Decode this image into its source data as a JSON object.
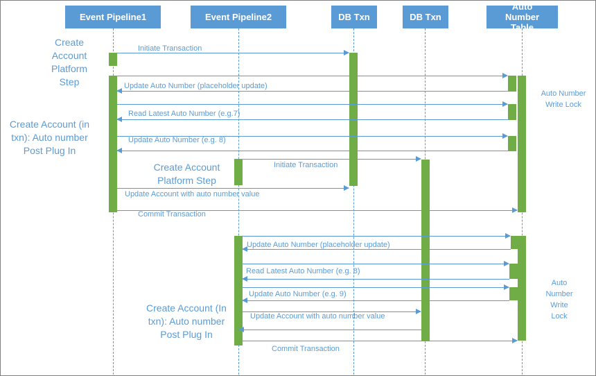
{
  "diagram": {
    "type": "sequence",
    "participants": [
      {
        "id": "ep1",
        "label": "Event Pipeline1"
      },
      {
        "id": "ep2",
        "label": "Event Pipeline2"
      },
      {
        "id": "db1",
        "label": "DB Txn"
      },
      {
        "id": "db2",
        "label": "DB Txn"
      },
      {
        "id": "ant",
        "label": "Auto Number Table"
      }
    ],
    "notes": {
      "ep1_platform": "Create Account Platform Step",
      "ep1_plugin": "Create Account (in txn): Auto number Post Plug In",
      "ep2_platform": "Create Account Platform Step",
      "ep2_plugin": "Create Account (In txn): Auto number Post Plug In",
      "lock1": "Auto Number Write Lock",
      "lock2": "Auto Number Write Lock"
    },
    "messages": [
      {
        "label": "Initiate Transaction",
        "from": "ep1",
        "to": "db1"
      },
      {
        "label": "",
        "from": "ep1",
        "to": "ant"
      },
      {
        "label": "Update Auto Number (placeholder update)",
        "from": "ant",
        "to": "ep1"
      },
      {
        "label": "",
        "from": "ep1",
        "to": "ant"
      },
      {
        "label": "Read Latest Auto Number (e.g.7)",
        "from": "ant",
        "to": "ep1"
      },
      {
        "label": "",
        "from": "ep1",
        "to": "ant"
      },
      {
        "label": "Update Auto Number (e.g. 8)",
        "from": "ant",
        "to": "ep1"
      },
      {
        "label": "Initiate Transaction",
        "from": "ep2",
        "to": "db2"
      },
      {
        "label": "Update Account with auto number value",
        "from": "ep1",
        "to": "db1"
      },
      {
        "label": "Commit Transaction",
        "from": "ep1",
        "to": "ant"
      },
      {
        "label": "",
        "from": "ep2",
        "to": "ant"
      },
      {
        "label": "Update Auto Number (placeholder update)",
        "from": "ant",
        "to": "ep2"
      },
      {
        "label": "",
        "from": "ep2",
        "to": "ant"
      },
      {
        "label": "Read Latest Auto Number (e.g. 8)",
        "from": "ant",
        "to": "ep2"
      },
      {
        "label": "",
        "from": "ep2",
        "to": "ant"
      },
      {
        "label": "Update Auto Number (e.g. 9)",
        "from": "ant",
        "to": "ep2"
      },
      {
        "label": "Update Account with auto number value",
        "from": "ep2",
        "to": "db2"
      },
      {
        "label": "",
        "from": "db2",
        "to": "ep2"
      },
      {
        "label": "Commit Transaction",
        "from": "ep2",
        "to": "ant"
      }
    ]
  },
  "colors": {
    "header": "#5b9bd5",
    "activation": "#70ad47",
    "line": "#5b9bd5",
    "text": "#5b9bd5"
  }
}
